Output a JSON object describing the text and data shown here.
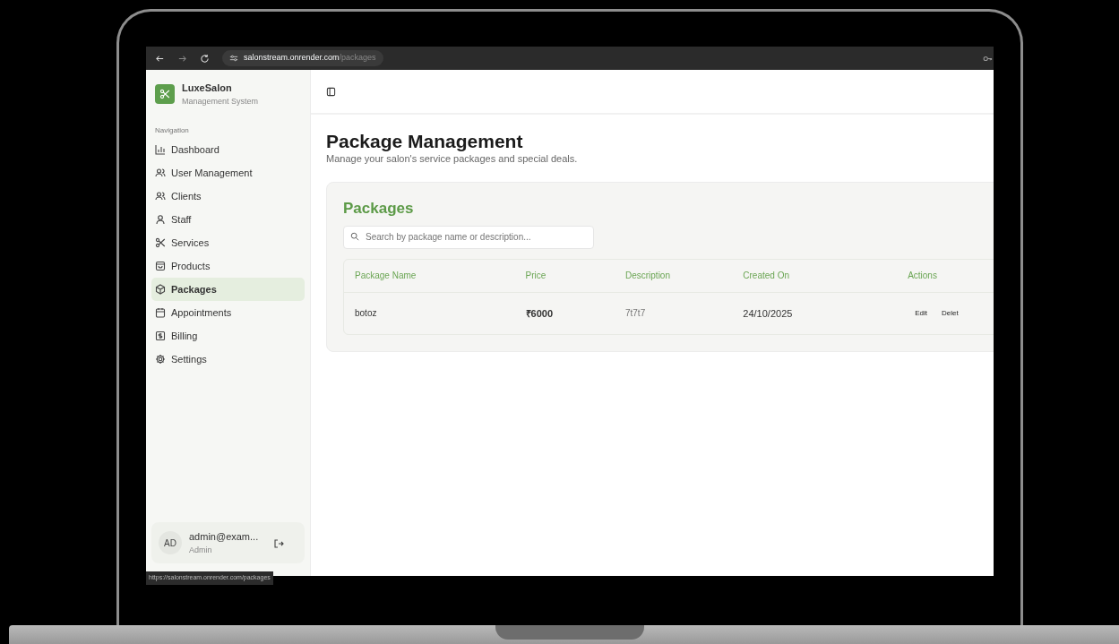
{
  "browser": {
    "host": "salonstream.onrender.com",
    "path": "/packages"
  },
  "brand": {
    "name": "LuxeSalon",
    "subtitle": "Management System"
  },
  "sidebar": {
    "section": "Navigation",
    "items": [
      {
        "label": "Dashboard",
        "kind": "chart",
        "selected": false
      },
      {
        "label": "User Management",
        "kind": "users",
        "selected": false
      },
      {
        "label": "Clients",
        "kind": "users",
        "selected": false
      },
      {
        "label": "Staff",
        "kind": "user",
        "selected": false
      },
      {
        "label": "Services",
        "kind": "scissors",
        "selected": false
      },
      {
        "label": "Products",
        "kind": "bag",
        "selected": false
      },
      {
        "label": "Packages",
        "kind": "box",
        "selected": true
      },
      {
        "label": "Appointments",
        "kind": "calendar",
        "selected": false
      },
      {
        "label": "Billing",
        "kind": "bill",
        "selected": false
      },
      {
        "label": "Settings",
        "kind": "gear",
        "selected": false
      }
    ]
  },
  "user": {
    "initials": "AD",
    "email": "admin@exam...",
    "role": "Admin"
  },
  "status_link": "https://salonstream.onrender.com/packages",
  "page": {
    "title": "Package Management",
    "subtitle": "Manage your salon's service packages and special deals."
  },
  "packages": {
    "heading": "Packages",
    "search": {
      "placeholder": "Search by package name or description..."
    },
    "table": {
      "columns": [
        "Package Name",
        "Price",
        "Description",
        "Created On",
        "Actions"
      ],
      "rows": [
        {
          "name": "botoz",
          "price": "₹6000",
          "description": "7t7t7",
          "created": "24/10/2025",
          "actions": [
            "Edit",
            "Delet"
          ]
        }
      ]
    }
  }
}
